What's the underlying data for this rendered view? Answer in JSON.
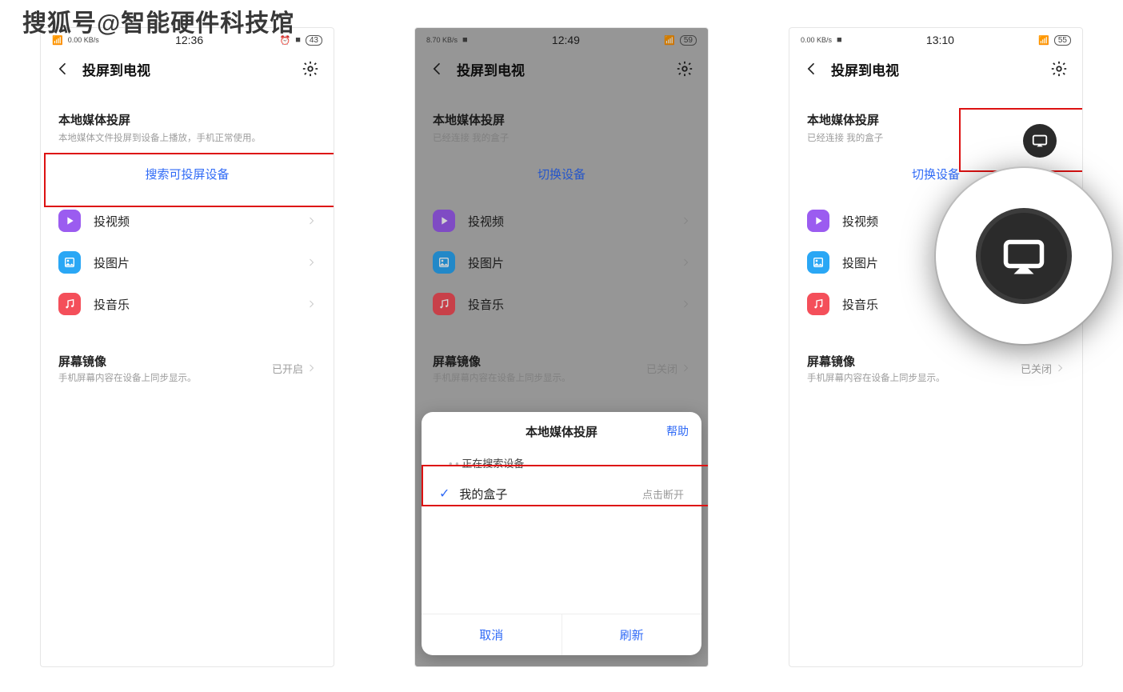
{
  "watermark": "搜狐号@智能硬件科技馆",
  "header": {
    "title": "投屏到电视"
  },
  "section_local_title": "本地媒体投屏",
  "media": {
    "video": "投视频",
    "image": "投图片",
    "music": "投音乐"
  },
  "mirror": {
    "title": "屏幕镜像",
    "sub": "手机屏幕内容在设备上同步显示。",
    "state_on": "已开启",
    "state_off": "已关闭"
  },
  "phone1": {
    "time": "12:36",
    "kbps": "0.00 KB/s",
    "battery": "43",
    "sub": "本地媒体文件投屏到设备上播放，手机正常使用。",
    "search_link": "搜索可投屏设备"
  },
  "phone2": {
    "time": "12:49",
    "kbps": "8.70 KB/s",
    "battery": "59",
    "sub": "已经连接 我的盒子",
    "switch_link": "切换设备",
    "sheet": {
      "title": "本地媒体投屏",
      "help": "帮助",
      "status": "正在搜索设备",
      "device": "我的盒子",
      "device_hint": "点击断开",
      "cancel": "取消",
      "refresh": "刷新"
    }
  },
  "phone3": {
    "time": "13:10",
    "kbps": "0.00 KB/s",
    "battery": "55",
    "sub": "已经连接 我的盒子",
    "switch_link": "切换设备"
  }
}
